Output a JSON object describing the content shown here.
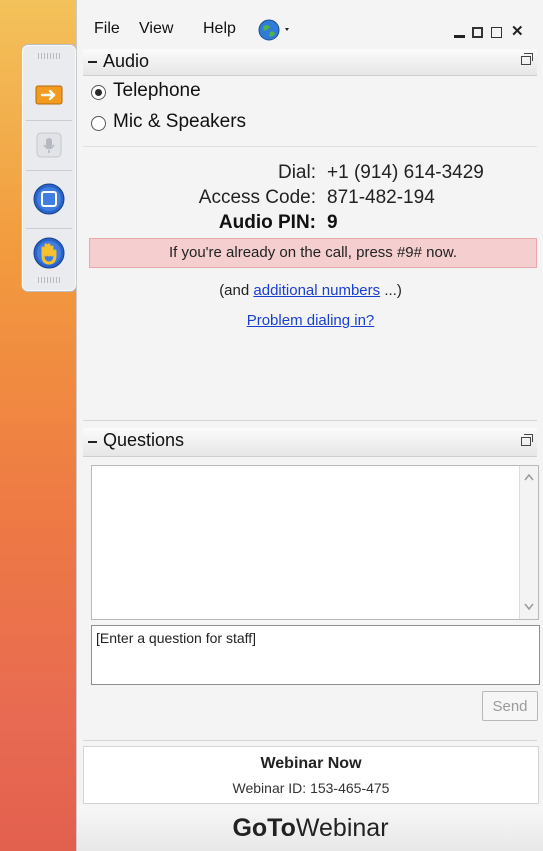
{
  "menu": {
    "file": "File",
    "view": "View",
    "help": "Help"
  },
  "audio": {
    "title": "Audio",
    "options": [
      "Telephone",
      "Mic & Speakers"
    ],
    "selected": "Telephone",
    "dial_label": "Dial:",
    "dial_value": "+1 (914) 614-3429",
    "code_label": "Access Code:",
    "code_value": "871-482-194",
    "pin_label": "Audio PIN:",
    "pin_value": "9",
    "notice": "If you're already on the call, press #9# now.",
    "additional_prefix": "(and",
    "additional_link": "additional numbers",
    "additional_suffix": "...)",
    "problem_link": "Problem dialing in?"
  },
  "questions": {
    "title": "Questions",
    "input_value": "[Enter a question for staff]",
    "send_label": "Send"
  },
  "webinar": {
    "name": "Webinar Now",
    "id_text": "Webinar ID: 153-465-475"
  },
  "brand": {
    "goto": "GoTo",
    "webinar": "Webinar"
  },
  "colors": {
    "accent_orange": "#f29a3e",
    "link_blue": "#1a3fcf",
    "notice_pink": "#f5cfcf",
    "toolbar_blue": "#2a63c9"
  },
  "icons": [
    "arrow-right-icon",
    "microphone-icon",
    "screen-icon",
    "hand-icon",
    "globe-icon",
    "minimize-icon",
    "maximize-icon",
    "popout-icon",
    "close-icon"
  ]
}
